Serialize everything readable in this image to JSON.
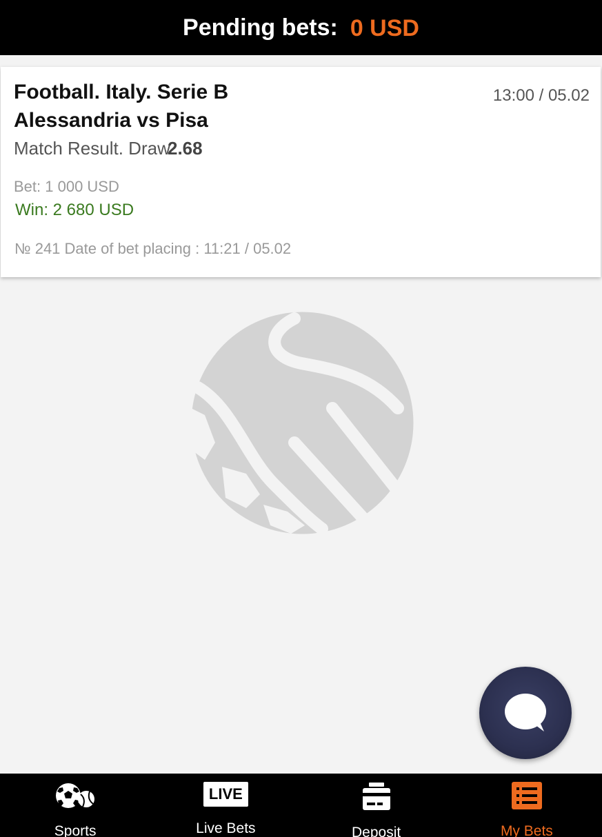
{
  "header": {
    "label": "Pending bets:",
    "value": "0 USD",
    "accent_color": "#ee6b1f"
  },
  "bet_card": {
    "title": "Football. Italy. Serie B",
    "match": "Alessandria vs Pisa",
    "datetime": "13:00 / 05.02",
    "market": "Match Result. Draw",
    "odds": "2.68",
    "bet": "Bet: 1 000 USD",
    "win": "Win: 2 680 USD",
    "meta": "№ 241 Date of bet placing : 11:21 / 05.02"
  },
  "background": {
    "icon": "football-ball-icon"
  },
  "chat": {
    "icon": "chat-bubble-icon"
  },
  "nav": {
    "items": [
      {
        "label": "Sports",
        "icon": "sports-balls-icon",
        "active": false
      },
      {
        "label": "Live Bets",
        "icon": "live-icon",
        "badge": "LIVE",
        "active": false
      },
      {
        "label": "Deposit",
        "icon": "card-icon",
        "active": false
      },
      {
        "label": "My Bets",
        "icon": "list-icon",
        "active": true
      }
    ]
  }
}
